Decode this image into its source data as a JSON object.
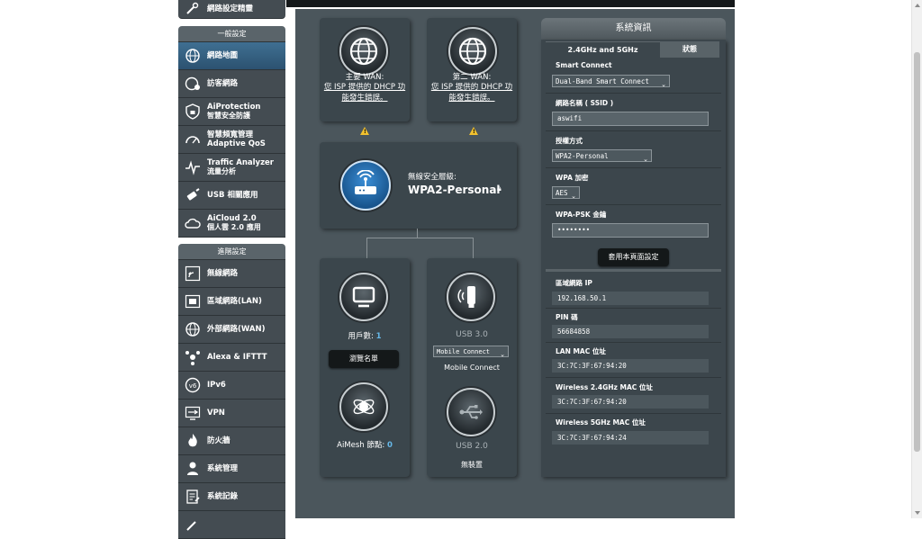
{
  "sidebar": {
    "top_item": "網路設定精靈",
    "general_header": "一般設定",
    "general_items": [
      {
        "label": "網路地圖",
        "sub": ""
      },
      {
        "label": "訪客網路",
        "sub": ""
      },
      {
        "label": "AiProtection",
        "sub": "智慧安全防護"
      },
      {
        "label": "智慧頻寬管理 Adaptive QoS",
        "sub": ""
      },
      {
        "label": "Traffic Analyzer",
        "sub": "流量分析"
      },
      {
        "label": "USB 相關應用",
        "sub": ""
      },
      {
        "label": "AiCloud 2.0",
        "sub": "個人雲 2.0 應用"
      }
    ],
    "advanced_header": "進階設定",
    "advanced_items": [
      {
        "label": "無線網路"
      },
      {
        "label": "區域網路(LAN)"
      },
      {
        "label": "外部網路(WAN)"
      },
      {
        "label": "Alexa & IFTTT"
      },
      {
        "label": "IPv6"
      },
      {
        "label": "VPN"
      },
      {
        "label": "防火牆"
      },
      {
        "label": "系統管理"
      },
      {
        "label": "系統記錄"
      }
    ]
  },
  "map": {
    "wan1": {
      "title": "主要 WAN:",
      "error_line1": "您 ISP 提供的 DHCP 功",
      "error_line2": "能發生錯誤。"
    },
    "wan2": {
      "title": "第二 WAN:",
      "error_line1": "您 ISP 提供的 DHCP 功",
      "error_line2": "能發生錯誤。"
    },
    "router": {
      "security_label": "無線安全層級:",
      "security_value": "WPA2-Personal"
    },
    "clients": {
      "label": "用戶數:",
      "count": "1",
      "button": "瀏覽名單"
    },
    "aimesh": {
      "label": "AiMesh 節點:",
      "count": "0"
    },
    "usb30": {
      "label": "USB 3.0",
      "select": "Mobile Connect",
      "caption": "Mobile Connect"
    },
    "usb20": {
      "label": "USB 2.0",
      "caption": "無裝置"
    }
  },
  "system_info": {
    "title": "系統資訊",
    "tabs": [
      "2.4GHz and 5GHz",
      "狀態"
    ],
    "smart_connect_label": "Smart Connect",
    "smart_connect_value": "Dual-Band Smart Connect",
    "ssid_label": "網路名稱 ( SSID )",
    "ssid_value": "aswifi",
    "auth_label": "授權方式",
    "auth_value": "WPA2-Personal",
    "enc_label": "WPA 加密",
    "enc_value": "AES",
    "psk_label": "WPA-PSK 金鑰",
    "psk_value": "••••••••",
    "apply_button": "套用本頁面設定",
    "lan_ip_label": "區域網路 IP",
    "lan_ip_value": "192.168.50.1",
    "pin_label": "PIN 碼",
    "pin_value": "56684858",
    "lan_mac_label": "LAN MAC 位址",
    "lan_mac_value": "3C:7C:3F:67:94:20",
    "mac24_label": "Wireless 2.4GHz MAC 位址",
    "mac24_value": "3C:7C:3F:67:94:20",
    "mac5_label": "Wireless 5GHz MAC 位址",
    "mac5_value": "3C:7C:3F:67:94:24"
  },
  "colors": {
    "accent": "#2c5270",
    "highlight_value": "#66b8e8",
    "warning": "#f2c12e"
  }
}
